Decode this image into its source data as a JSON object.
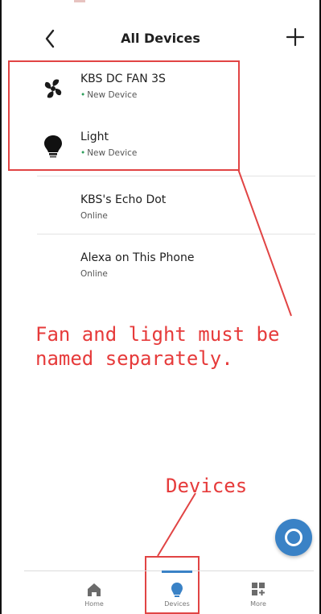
{
  "header": {
    "title": "All Devices"
  },
  "devices": [
    {
      "name": "KBS DC FAN 3S",
      "status": "New Device",
      "icon": "fan-icon"
    },
    {
      "name": "Light",
      "status": "New Device",
      "icon": "bulb-icon"
    },
    {
      "name": "KBS's Echo Dot",
      "status": "Online"
    },
    {
      "name": "Alexa on This Phone",
      "status": "Online"
    }
  ],
  "annotations": {
    "note": "Fan and light must be\nnamed separately.",
    "devices_label": "Devices"
  },
  "nav": {
    "home": "Home",
    "devices": "Devices",
    "more": "More"
  },
  "colors": {
    "accent": "#3a82c6",
    "annotation": "#e63b3b",
    "new_device_dot": "#2e9e5b"
  }
}
